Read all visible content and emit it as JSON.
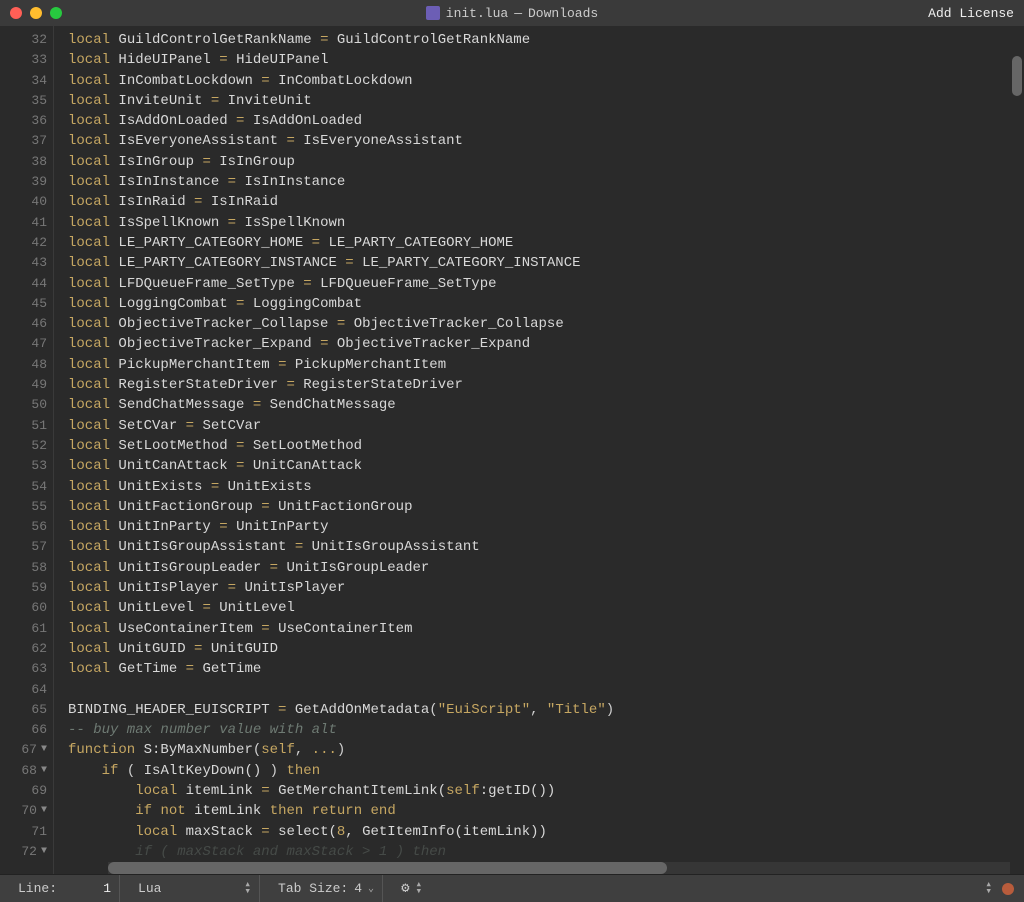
{
  "titlebar": {
    "filename": "init.lua",
    "separator": "—",
    "folder": "Downloads",
    "add_license": "Add License"
  },
  "gutter": {
    "start": 32,
    "end": 72,
    "fold_lines": [
      67,
      68,
      70,
      72
    ]
  },
  "code_lines": [
    {
      "type": "local",
      "name": "GuildControlGetRankName",
      "rhs": "GuildControlGetRankName"
    },
    {
      "type": "local",
      "name": "HideUIPanel",
      "rhs": "HideUIPanel"
    },
    {
      "type": "local",
      "name": "InCombatLockdown",
      "rhs": "InCombatLockdown"
    },
    {
      "type": "local",
      "name": "InviteUnit",
      "rhs": "InviteUnit"
    },
    {
      "type": "local",
      "name": "IsAddOnLoaded",
      "rhs": "IsAddOnLoaded"
    },
    {
      "type": "local",
      "name": "IsEveryoneAssistant",
      "rhs": "IsEveryoneAssistant"
    },
    {
      "type": "local",
      "name": "IsInGroup",
      "rhs": "IsInGroup"
    },
    {
      "type": "local",
      "name": "IsInInstance",
      "rhs": "IsInInstance"
    },
    {
      "type": "local",
      "name": "IsInRaid",
      "rhs": "IsInRaid"
    },
    {
      "type": "local",
      "name": "IsSpellKnown",
      "rhs": "IsSpellKnown"
    },
    {
      "type": "local",
      "name": "LE_PARTY_CATEGORY_HOME",
      "rhs": "LE_PARTY_CATEGORY_HOME"
    },
    {
      "type": "local",
      "name": "LE_PARTY_CATEGORY_INSTANCE",
      "rhs": "LE_PARTY_CATEGORY_INSTANCE"
    },
    {
      "type": "local",
      "name": "LFDQueueFrame_SetType",
      "rhs": "LFDQueueFrame_SetType"
    },
    {
      "type": "local",
      "name": "LoggingCombat",
      "rhs": "LoggingCombat"
    },
    {
      "type": "local",
      "name": "ObjectiveTracker_Collapse",
      "rhs": "ObjectiveTracker_Collapse"
    },
    {
      "type": "local",
      "name": "ObjectiveTracker_Expand",
      "rhs": "ObjectiveTracker_Expand"
    },
    {
      "type": "local",
      "name": "PickupMerchantItem",
      "rhs": "PickupMerchantItem"
    },
    {
      "type": "local",
      "name": "RegisterStateDriver",
      "rhs": "RegisterStateDriver"
    },
    {
      "type": "local",
      "name": "SendChatMessage",
      "rhs": "SendChatMessage"
    },
    {
      "type": "local",
      "name": "SetCVar",
      "rhs": "SetCVar"
    },
    {
      "type": "local",
      "name": "SetLootMethod",
      "rhs": "SetLootMethod"
    },
    {
      "type": "local",
      "name": "UnitCanAttack",
      "rhs": "UnitCanAttack"
    },
    {
      "type": "local",
      "name": "UnitExists",
      "rhs": "UnitExists"
    },
    {
      "type": "local",
      "name": "UnitFactionGroup",
      "rhs": "UnitFactionGroup"
    },
    {
      "type": "local",
      "name": "UnitInParty",
      "rhs": "UnitInParty"
    },
    {
      "type": "local",
      "name": "UnitIsGroupAssistant",
      "rhs": "UnitIsGroupAssistant"
    },
    {
      "type": "local",
      "name": "UnitIsGroupLeader",
      "rhs": "UnitIsGroupLeader"
    },
    {
      "type": "local",
      "name": "UnitIsPlayer",
      "rhs": "UnitIsPlayer"
    },
    {
      "type": "local",
      "name": "UnitLevel",
      "rhs": "UnitLevel"
    },
    {
      "type": "local",
      "name": "UseContainerItem",
      "rhs": "UseContainerItem"
    },
    {
      "type": "local",
      "name": "UnitGUID",
      "rhs": "UnitGUID"
    },
    {
      "type": "local",
      "name": "GetTime",
      "rhs": "GetTime"
    },
    {
      "type": "blank"
    },
    {
      "type": "assign",
      "lhs": "BINDING_HEADER_EUISCRIPT",
      "rhs_func": "GetAddOnMetadata",
      "args": [
        "\"EuiScript\"",
        "\"Title\""
      ]
    },
    {
      "type": "comment",
      "text": "-- buy max number value with alt"
    },
    {
      "type": "funcdef",
      "name": "S:ByMaxNumber",
      "params": [
        "self",
        "..."
      ]
    },
    {
      "type": "if",
      "cond": "IsAltKeyDown()",
      "indent": 1
    },
    {
      "type": "local_expr",
      "indent": 2,
      "name": "itemLink",
      "rhs": "GetMerchantItemLink(self:getID())",
      "render": "GetMerchantItemLink(<span class='param'>self</span>:getID())"
    },
    {
      "type": "ifnot",
      "indent": 2,
      "cond": "itemLink",
      "tail": "return end"
    },
    {
      "type": "local_expr",
      "indent": 2,
      "name": "maxStack",
      "rhs": "select(8, GetItemInfo(itemLink))",
      "render": "select(<span class='num'>8</span>, GetItemInfo(itemLink))"
    },
    {
      "type": "partial",
      "indent": 2,
      "text": "if ( maxStack and maxStack > 1 ) then",
      "faded": true
    }
  ],
  "statusbar": {
    "line_label": "Line:",
    "line_value": "1",
    "language": "Lua",
    "tab_label": "Tab Size:",
    "tab_value": "4"
  }
}
